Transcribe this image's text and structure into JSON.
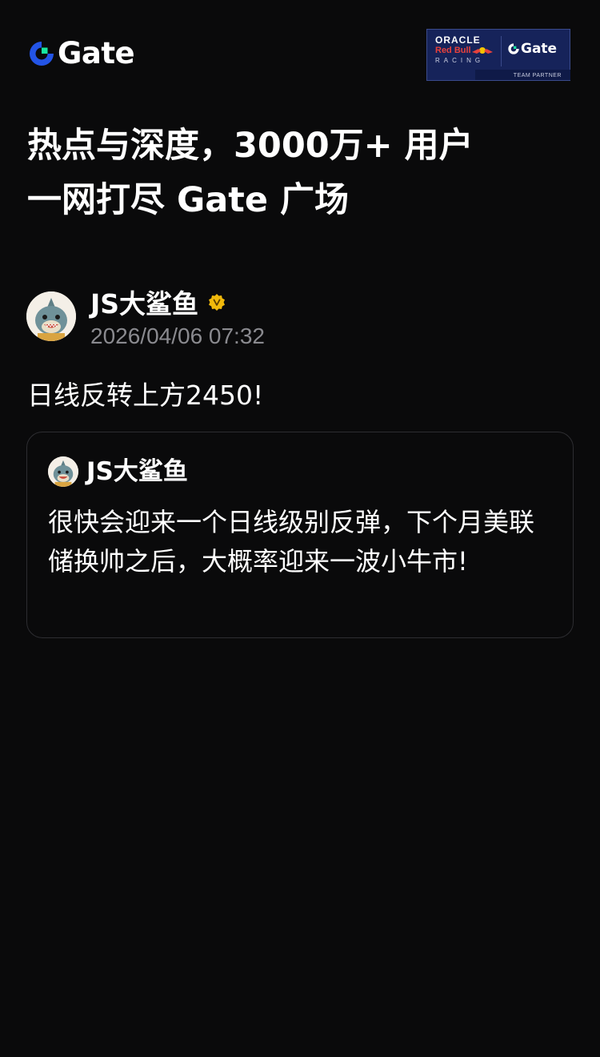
{
  "header": {
    "logo_text": "Gate",
    "partner_badge": {
      "oracle": "ORACLE",
      "redbull": "Red Bull",
      "racing": "RACING",
      "gate": "Gate",
      "team_partner": "TEAM PARTNER"
    }
  },
  "headline": {
    "line1": "热点与深度，3000万+ 用户",
    "line2": "一网打尽 Gate 广场"
  },
  "post": {
    "author": "JS大鲨鱼",
    "verified_icon": "verified-badge-icon",
    "timestamp": "2026/04/06 07:32",
    "text": "日线反转上方2450!",
    "quote": {
      "author": "JS大鲨鱼",
      "text": "很快会迎来一个日线级别反弹，下个月美联储换帅之后，大概率迎来一波小牛市!"
    }
  },
  "colors": {
    "background": "#0a0a0b",
    "logo_accent": "#2354e6",
    "logo_green": "#17e6a1",
    "verified_gold": "#f0b90b",
    "muted_text": "#8a8a8f",
    "card_border": "#2d2d31"
  }
}
